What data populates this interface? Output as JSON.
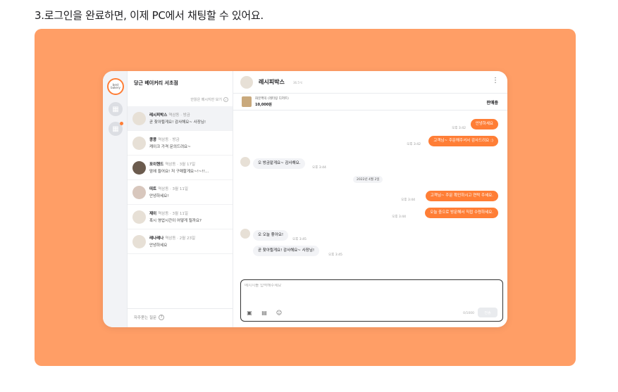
{
  "caption": "3.로그인을 완료하면, 이제 PC에서 채팅할 수 있어요.",
  "colors": {
    "hero_bg": "#ff9e66",
    "accent": "#ff7e36"
  },
  "rail": {
    "my_avatar_text": "best bakery"
  },
  "list": {
    "store_name": "당근 베이커리 서초점",
    "unread_toggle": "안읽은 메시지만 보기",
    "rooms": [
      {
        "name": "레시피박스",
        "meta": "역삼동 · 방금",
        "preview": "곧 찾아뵐게요! 감사해요~ 사장님!"
      },
      {
        "name": "콩콩",
        "meta": "역삼동 · 방금",
        "preview": "케이크 가격 문의드려요~"
      },
      {
        "name": "포이핸드",
        "meta": "역삼동 · 3월 17일",
        "preview": "맘에 들어요! 저 구매할게요~!~!!..."
      },
      {
        "name": "띠트",
        "meta": "역삼동 · 3월 11일",
        "preview": "안녕하세요!"
      },
      {
        "name": "제이",
        "meta": "역삼동 · 3월 11일",
        "preview": "혹시 영업시간이 어떻게 될까요?"
      },
      {
        "name": "레나레나",
        "meta": "역삼동 · 2월 23일",
        "preview": "안녕하세요"
      }
    ],
    "faq": "자주묻는 질문"
  },
  "chat": {
    "partner_name": "레시피박스",
    "partner_temp": "36.5℃",
    "product_name": "화분케익 (레터링 디저트)",
    "product_price": "10,000원",
    "product_status": "판매중",
    "date_divider": "2022년 4월 2일",
    "messages": {
      "m1": {
        "text": "안녕하세요",
        "time": "오후 3:42"
      },
      "m2": {
        "text": "고객님~ 주문해주셔서 감사드려요 :)",
        "time": "오후 3:42"
      },
      "m3": {
        "text": "오 방금맡게요~ 감사해요.",
        "time": "오후 3:44"
      },
      "m4": {
        "text": "고객님~ 주문 확인하시고 연락 주세요.",
        "time": "오후 3:44"
      },
      "m5": {
        "text": "오늘 중으로 방문해서 직접 수령하세요.",
        "time": "오후 3:44"
      },
      "m6": {
        "text": "오 오늘 좋아요!",
        "time": "오후 3:45"
      },
      "m7": {
        "text": "곧 찾아뵐게요! 감사해요~ 사장님!",
        "time": "오후 3:45"
      }
    },
    "composer": {
      "placeholder": "메시지를 입력해주세요",
      "counter": "0/1000",
      "send_label": "전송"
    }
  }
}
